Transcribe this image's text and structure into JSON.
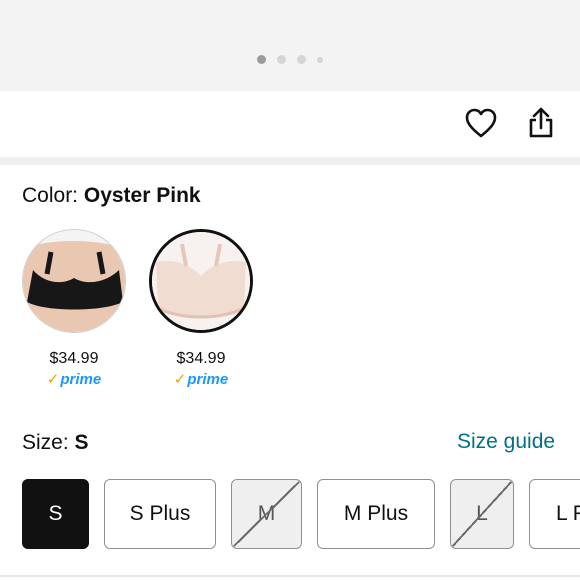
{
  "carousel": {
    "dot_count": 4,
    "active_index": 0
  },
  "actions": {
    "wishlist_icon": "heart-icon",
    "share_icon": "share-icon"
  },
  "color": {
    "label": "Color: ",
    "selected": "Oyster Pink",
    "options": [
      {
        "name": "black-bra",
        "price": "$34.99",
        "prime_check": "✓",
        "prime": "prime",
        "swatch_color": "#1a1a1a"
      },
      {
        "name": "oyster-pink-bra",
        "price": "$34.99",
        "prime_check": "✓",
        "prime": "prime",
        "swatch_color": "#f1dcd2"
      }
    ]
  },
  "size": {
    "label": "Size: ",
    "selected": "S",
    "guide": "Size guide",
    "options": [
      {
        "label": "S",
        "state": "selected"
      },
      {
        "label": "S Plus",
        "state": "available"
      },
      {
        "label": "M",
        "state": "unavailable"
      },
      {
        "label": "M Plus",
        "state": "available"
      },
      {
        "label": "L",
        "state": "unavailable"
      },
      {
        "label": "L P",
        "state": "available"
      }
    ]
  },
  "colors": {
    "link": "#007185",
    "prime_blue": "#1a98ff",
    "prime_check": "#f7a000"
  }
}
